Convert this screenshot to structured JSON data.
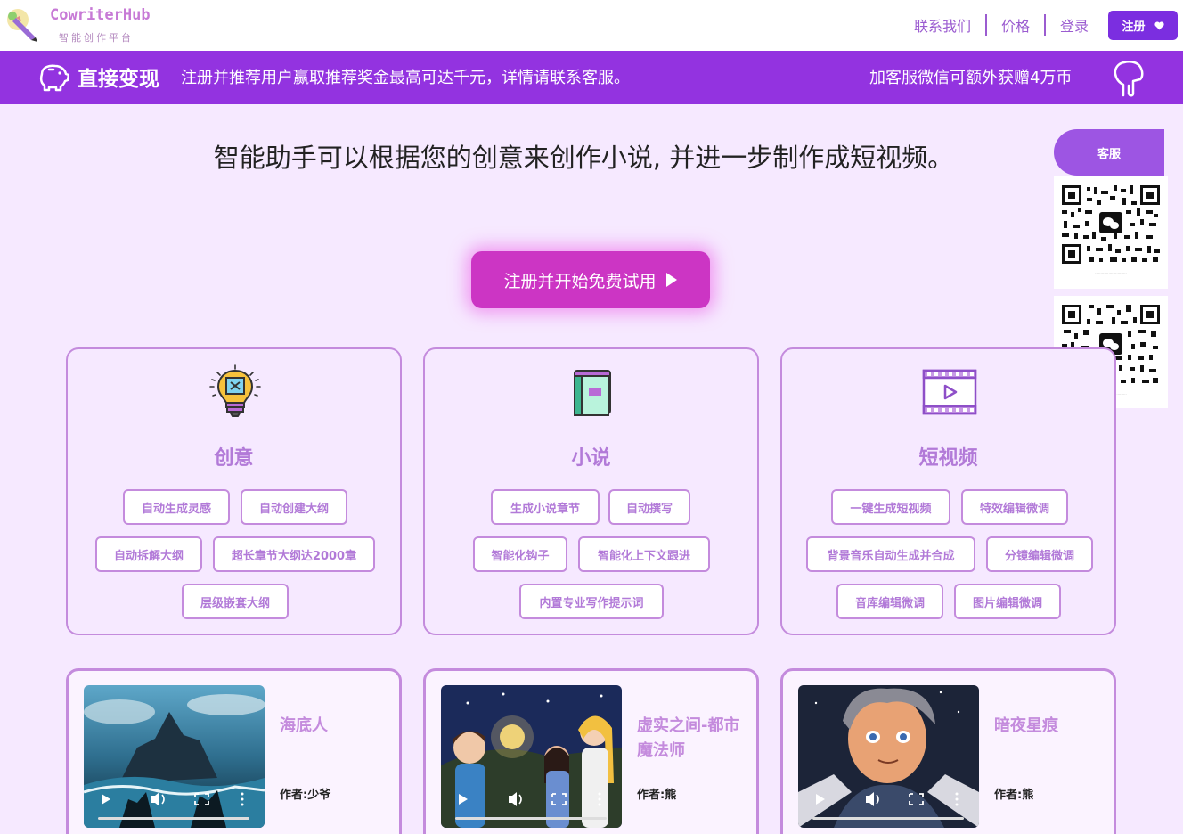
{
  "header": {
    "brand": "CowriterHub",
    "brand_sub": "智能创作平台",
    "nav": [
      "联系我们",
      "价格",
      "登录"
    ],
    "register_label": "注册"
  },
  "promo": {
    "title": "直接变现",
    "text": "注册并推荐用户赢取推荐奖金最高可达千元，详情请联系客服。",
    "right_text": "加客服微信可额外获赠4万币"
  },
  "hero": {
    "title": "智能助手可以根据您的创意来创作小说, 并进一步制作成短视频。",
    "cta_label": "注册并开始免费试用"
  },
  "service": {
    "label": "客服"
  },
  "features": [
    {
      "title": "创意",
      "icon": "lightbulb-icon",
      "tags": [
        "自动生成灵感",
        "自动创建大纲",
        "自动拆解大纲",
        "超长章节大纲达2000章",
        "层级嵌套大纲"
      ]
    },
    {
      "title": "小说",
      "icon": "book-icon",
      "tags": [
        "生成小说章节",
        "自动撰写",
        "智能化钩子",
        "智能化上下文跟进",
        "内置专业写作提示词"
      ]
    },
    {
      "title": "短视频",
      "icon": "video-icon",
      "tags": [
        "一键生成短视频",
        "特效编辑微调",
        "背景音乐自动生成并合成",
        "分镜编辑微调",
        "音库编辑微调",
        "图片编辑微调"
      ]
    }
  ],
  "stories": [
    {
      "title": "海底人",
      "author": "作者:少爷"
    },
    {
      "title": "虚实之间-都市魔法师",
      "author": "作者:熊"
    },
    {
      "title": "暗夜星痕",
      "author": "作者:熊"
    }
  ],
  "colors": {
    "accent": "#9333e0",
    "cta": "#cc35c4",
    "card_border": "#c48bdd",
    "background": "#f6e9ff"
  }
}
